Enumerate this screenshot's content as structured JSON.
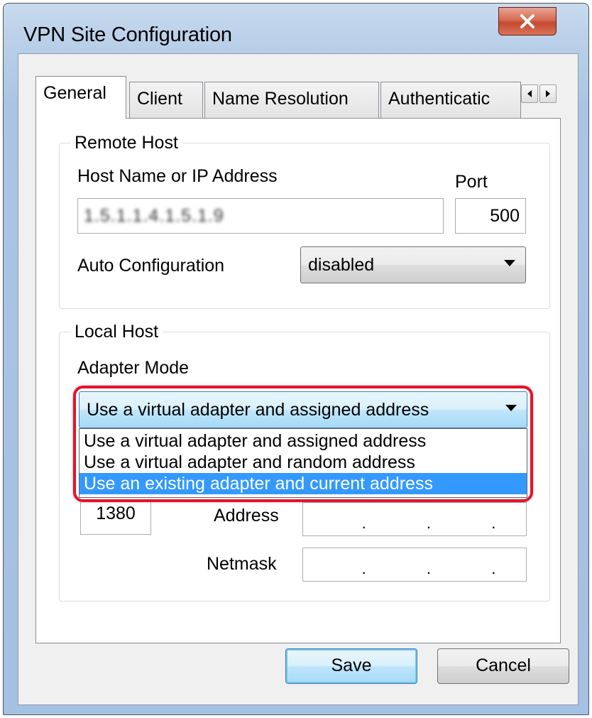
{
  "window": {
    "title": "VPN Site Configuration"
  },
  "tabs": [
    "General",
    "Client",
    "Name Resolution",
    "Authenticatic"
  ],
  "remote_host": {
    "group_label": "Remote Host",
    "host_label": "Host Name or IP Address",
    "host_value": "1.5.1.1.4.1.5.1.9",
    "port_label": "Port",
    "port_value": "500",
    "auto_config_label": "Auto Configuration",
    "auto_config_value": "disabled"
  },
  "local_host": {
    "group_label": "Local Host",
    "adapter_mode_label": "Adapter Mode",
    "adapter_mode_value": "Use a virtual adapter and assigned address",
    "adapter_options": [
      "Use a virtual adapter and assigned address",
      "Use a virtual adapter and random address",
      "Use an existing adapter and current address"
    ],
    "highlighted_option": 2,
    "mtu_partial": "1380",
    "address_label": "Address",
    "netmask_label": "Netmask",
    "ip_dots": "."
  },
  "buttons": {
    "save": "Save",
    "cancel": "Cancel"
  },
  "colors": {
    "selection": "#3399ff",
    "highlight_ring": "#e0152c",
    "close_button": "#c44a30"
  }
}
